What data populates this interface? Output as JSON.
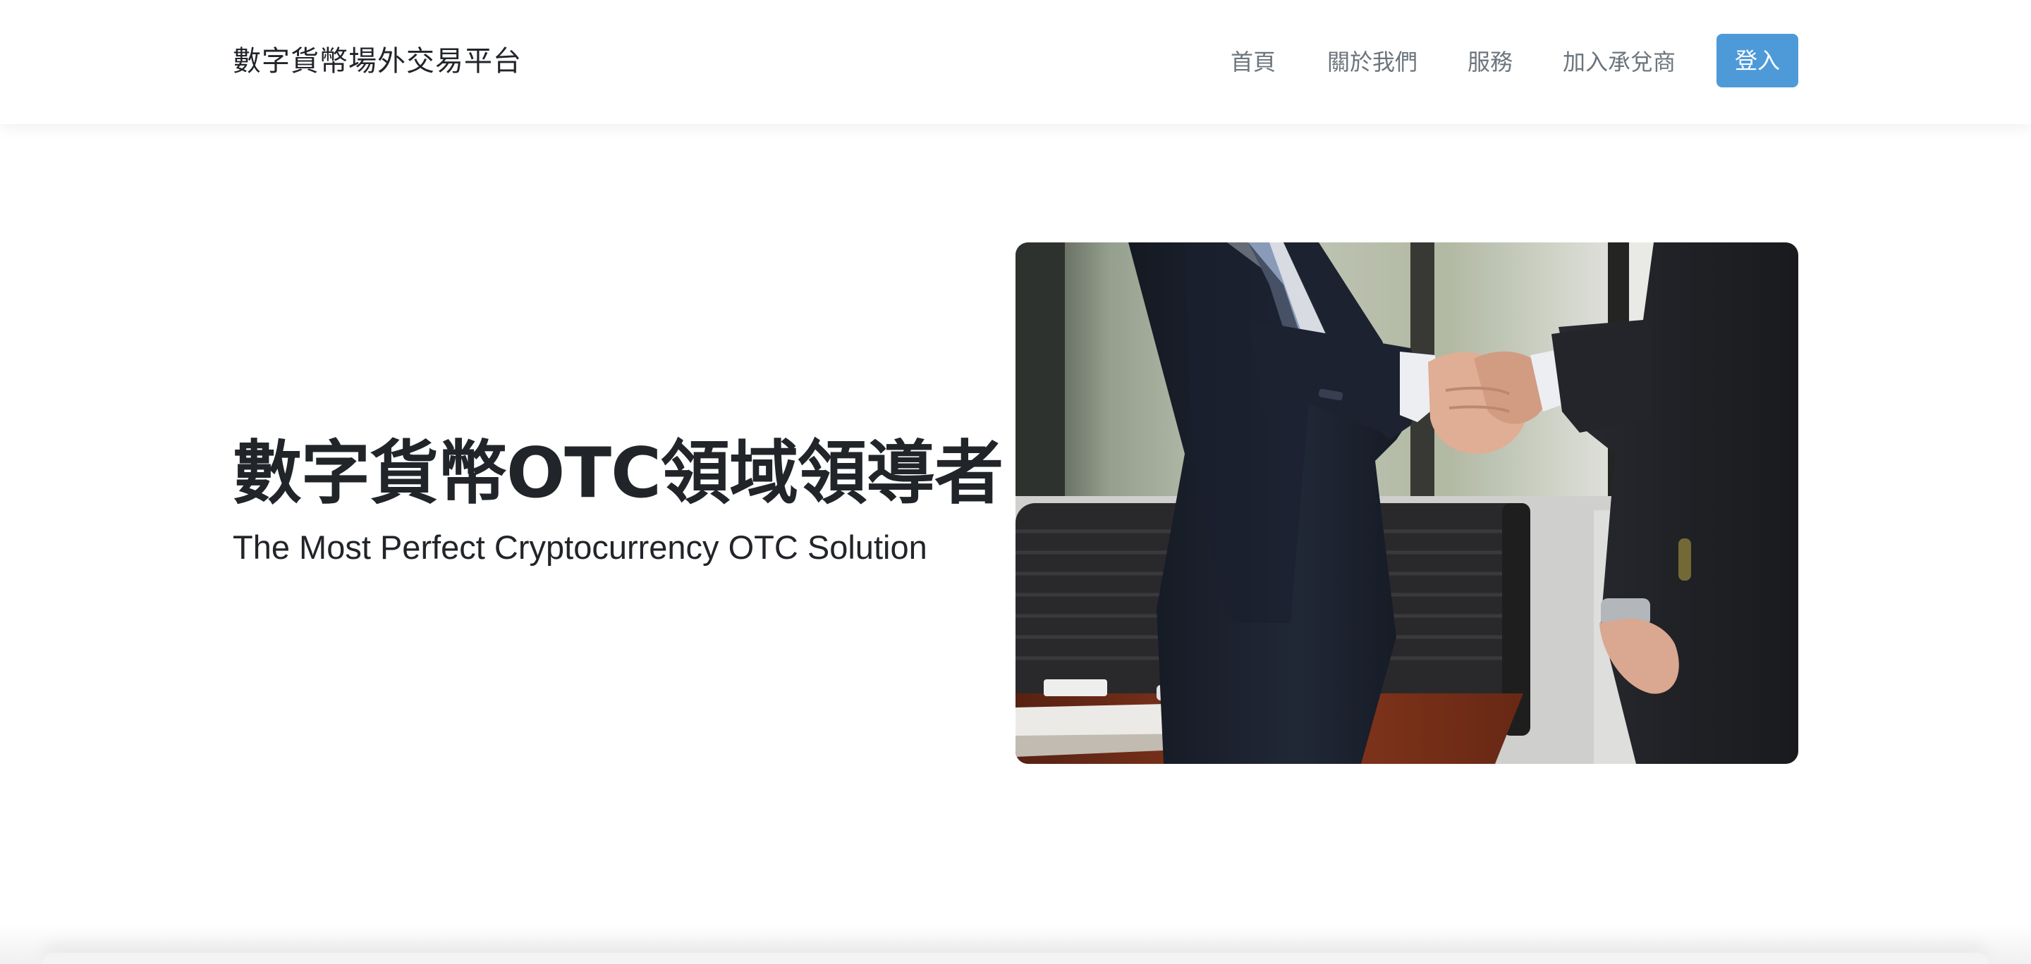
{
  "navbar": {
    "brand": "數字貨幣場外交易平台",
    "links": [
      "首頁",
      "關於我們",
      "服務",
      "加入承兌商"
    ],
    "login_label": "登入"
  },
  "hero": {
    "title": "數字貨幣OTC領域領導者",
    "subtitle": "The Most Perfect Cryptocurrency OTC Solution",
    "image_subject": "business-handshake-photo"
  },
  "colors": {
    "accent": "#4e9ad8",
    "text": "#212529",
    "nav_text": "#6c757d"
  }
}
